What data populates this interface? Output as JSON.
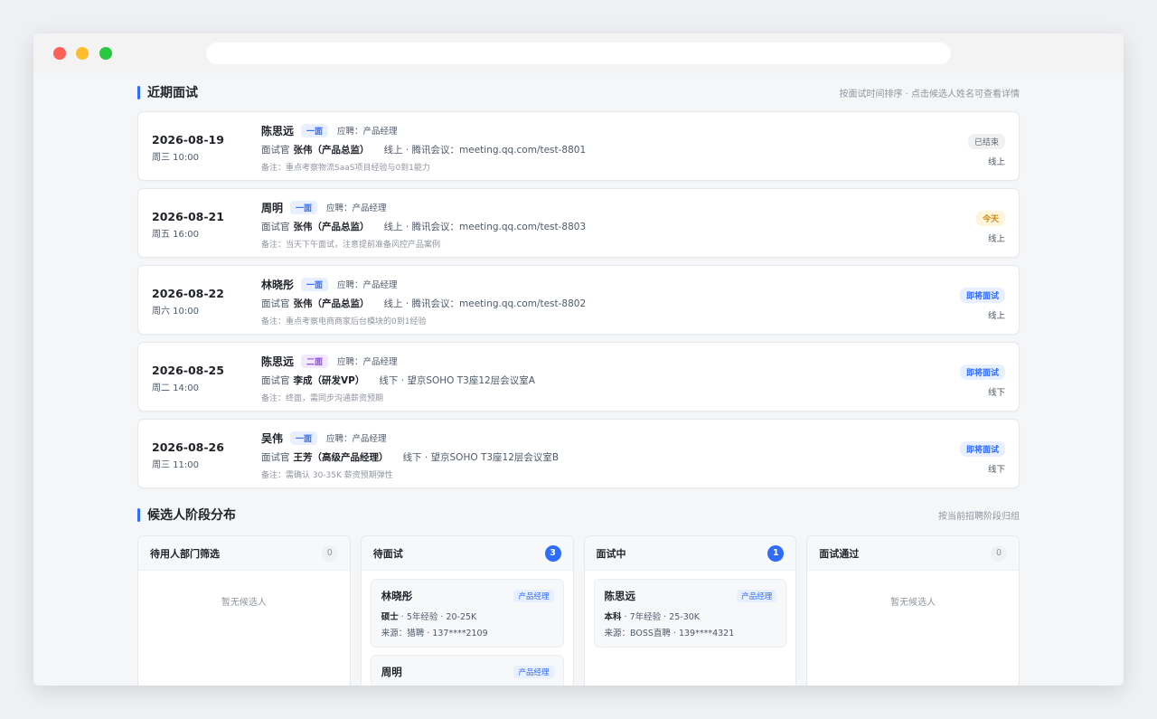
{
  "interviews_section": {
    "title": "近期面试",
    "hint": "按面试时间排序 · 点击候选人姓名可查看详情",
    "interviewer_prefix": "面试官",
    "items": [
      {
        "date": "2026-08-19",
        "time": "周三 10:00",
        "name": "陈思远",
        "round": "一面",
        "apply": "应聘：产品经理",
        "interviewer": "张伟（产品总监）",
        "location": "线上 · 腾讯会议：meeting.qq.com/test-8801",
        "note": "备注：重点考察物流SaaS项目经验与0到1能力",
        "status": "已结束",
        "mode": "线上"
      },
      {
        "date": "2026-08-21",
        "time": "周五 16:00",
        "name": "周明",
        "round": "一面",
        "apply": "应聘：产品经理",
        "interviewer": "张伟（产品总监）",
        "location": "线上 · 腾讯会议：meeting.qq.com/test-8803",
        "note": "备注：当天下午面试，注意提前准备风控产品案例",
        "status": "今天",
        "mode": "线上"
      },
      {
        "date": "2026-08-22",
        "time": "周六 10:00",
        "name": "林晓彤",
        "round": "一面",
        "apply": "应聘：产品经理",
        "interviewer": "张伟（产品总监）",
        "location": "线上 · 腾讯会议：meeting.qq.com/test-8802",
        "note": "备注：重点考察电商商家后台模块的0到1经验",
        "status": "即将面试",
        "mode": "线上"
      },
      {
        "date": "2026-08-25",
        "time": "周二 14:00",
        "name": "陈思远",
        "round": "二面",
        "apply": "应聘：产品经理",
        "interviewer": "李成（研发VP）",
        "location": "线下 · 望京SOHO T3座12层会议室A",
        "note": "备注：终面，需同步沟通薪资预期",
        "status": "即将面试",
        "mode": "线下"
      },
      {
        "date": "2026-08-26",
        "time": "周三 11:00",
        "name": "吴伟",
        "round": "一面",
        "apply": "应聘：产品经理",
        "interviewer": "王芳（高级产品经理）",
        "location": "线下 · 望京SOHO T3座12层会议室B",
        "note": "备注：需确认 30-35K 薪资预期弹性",
        "status": "即将面试",
        "mode": "线下"
      }
    ]
  },
  "pipeline_section": {
    "title": "候选人阶段分布",
    "hint": "按当前招聘阶段归组",
    "empty_text": "暂无候选人",
    "columns": [
      {
        "title": "待用人部门筛选",
        "count": "0",
        "candidates": []
      },
      {
        "title": "待面试",
        "count": "3",
        "candidates": [
          {
            "name": "林晓彤",
            "position": "产品经理",
            "degree": "硕士",
            "info": " · 5年经验 · 20-25K",
            "source": "来源：猎聘 · 137****2109"
          },
          {
            "name": "周明",
            "position": "产品经理",
            "degree": "",
            "info": "",
            "source": ""
          }
        ]
      },
      {
        "title": "面试中",
        "count": "1",
        "candidates": [
          {
            "name": "陈思远",
            "position": "产品经理",
            "degree": "本科",
            "info": " · 7年经验 · 25-30K",
            "source": "来源：BOSS直聘 · 139****4321"
          }
        ]
      },
      {
        "title": "面试通过",
        "count": "0",
        "candidates": []
      }
    ]
  },
  "colors": {
    "accent": "#2f6bff",
    "today": "#d4880f",
    "round2": "#8e43e7"
  }
}
